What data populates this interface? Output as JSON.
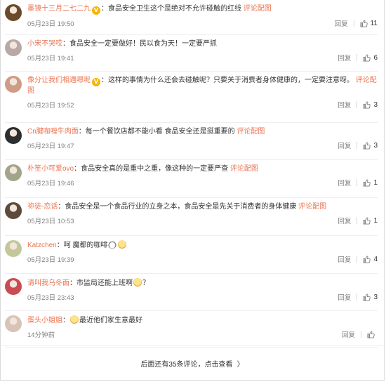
{
  "comments": [
    {
      "name": "墨镜十三月二七二九",
      "verified": true,
      "sep": "：",
      "text": "食品安全卫生这个是绝对不允许碰触的红线",
      "pic": "评论配图",
      "time": "05月23日 19:50",
      "reply": "回复",
      "likes": "11",
      "avatar_color": "#6b4a2a"
    },
    {
      "name": "小宋不哭哎",
      "verified": false,
      "sep": "：",
      "text": "食品安全一定要做好！民以食为天！一定要严抓",
      "pic": "",
      "time": "05月23日 19:41",
      "reply": "回复",
      "likes": "6",
      "avatar_color": "#b9a9a6"
    },
    {
      "name": "像分让我们相遇嗯呢",
      "verified": true,
      "sep": "：",
      "text": "这样的事情为什么还会去碰触呢？只要关于消费者身体健康的，一定要注意呀。",
      "pic": "评论配图",
      "time": "05月23日 19:52",
      "reply": "回复",
      "likes": "3",
      "avatar_color": "#cf9c85"
    },
    {
      "name": "Cn腱咖喱牛肉面",
      "verified": false,
      "sep": "：",
      "text": "每一个餐饮店都不能小看 食品安全还是挺重要的",
      "pic": "评论配图",
      "time": "05月23日 19:47",
      "reply": "回复",
      "likes": "3",
      "avatar_color": "#2e2e2e"
    },
    {
      "name": "朴笙小可爱ovo",
      "verified": false,
      "sep": "：",
      "text": "食品安全真的是重中之重，像这种的一定要严查",
      "pic": "评论配图",
      "time": "05月23日 19:46",
      "reply": "回复",
      "likes": "1",
      "avatar_color": "#a3a58b"
    },
    {
      "name": "祢徒-恋话",
      "verified": false,
      "sep": "：",
      "text": "食品安全是一个食品行业的立身之本，食品安全是先关于消费者的身体健康",
      "pic": "评论配图",
      "time": "05月23日 10:53",
      "reply": "回复",
      "likes": "1",
      "avatar_color": "#5d4a3a"
    },
    {
      "name": "Katzchen",
      "verified": false,
      "sep": "：",
      "text": "呵 魔都的咖啡",
      "pic": "",
      "time": "05月23日 19:39",
      "reply": "回复",
      "likes": "4",
      "avatar_color": "#c3c89a"
    },
    {
      "name": "请叫我乌冬面",
      "verified": false,
      "sep": "：",
      "text": "市监局还能上班啊",
      "text_after": "？",
      "pic": "",
      "time": "05月23日 23:43",
      "reply": "回复",
      "likes": "3",
      "avatar_color": "#c94c55"
    },
    {
      "name": "蛋头小姐姐",
      "verified": false,
      "sep": "：",
      "text": "最近他们家生意最好",
      "pic": "",
      "time": "14分钟前",
      "reply": "回复",
      "likes": "",
      "avatar_color": "#d8c3b6"
    }
  ],
  "more_link": {
    "label": "后面还有35条评论，点击查看",
    "chevron": "〉"
  },
  "colors": {
    "accent": "#eb7350",
    "meta": "#808080",
    "text": "#333333",
    "verified": "#f7b500"
  }
}
